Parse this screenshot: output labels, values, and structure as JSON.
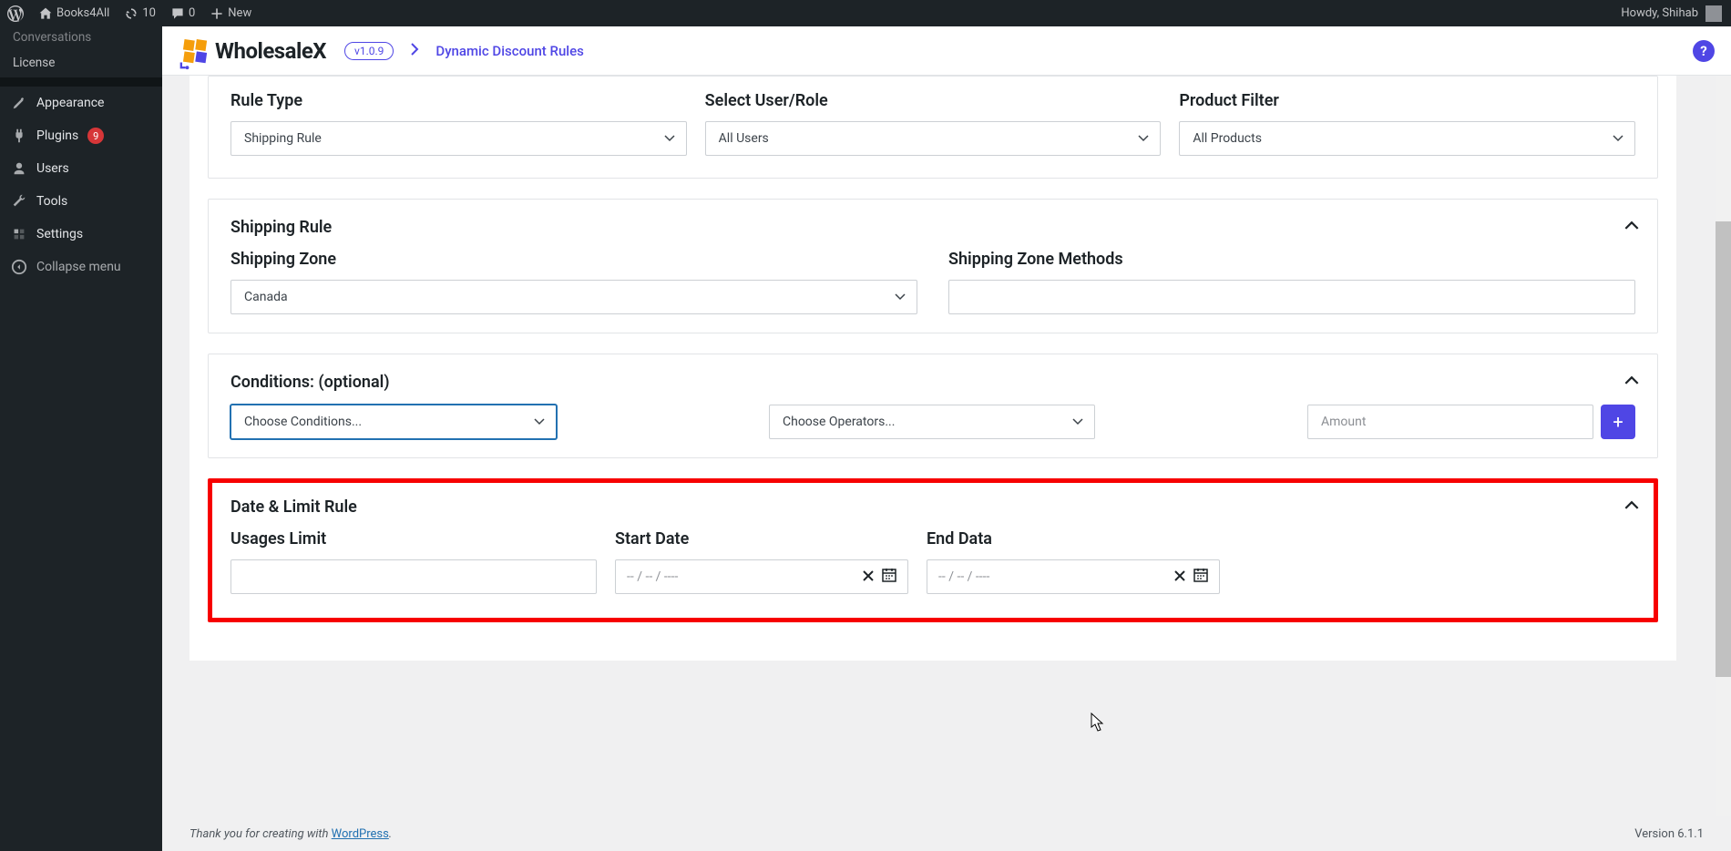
{
  "toolbar": {
    "site_name": "Books4All",
    "updates_count": "10",
    "comments_count": "0",
    "new_label": "New",
    "greeting": "Howdy, Shihab"
  },
  "sidebar": {
    "items": [
      {
        "label": "Conversations"
      },
      {
        "label": "License"
      },
      {
        "label": "Appearance"
      },
      {
        "label": "Plugins",
        "badge": "9"
      },
      {
        "label": "Users"
      },
      {
        "label": "Tools"
      },
      {
        "label": "Settings"
      },
      {
        "label": "Collapse menu"
      }
    ]
  },
  "header": {
    "brand": "WholesaleX",
    "version": "v1.0.9",
    "crumb": "Dynamic Discount Rules",
    "help": "?"
  },
  "panels": {
    "rule": {
      "rule_type_label": "Rule Type",
      "rule_type_value": "Shipping Rule",
      "user_label": "Select User/Role",
      "user_value": "All Users",
      "filter_label": "Product Filter",
      "filter_value": "All Products"
    },
    "shipping": {
      "title": "Shipping Rule",
      "zone_label": "Shipping Zone",
      "zone_value": "Canada",
      "methods_label": "Shipping Zone Methods"
    },
    "conditions": {
      "title": "Conditions: (optional)",
      "choose_cond": "Choose Conditions...",
      "choose_op": "Choose Operators...",
      "amount_ph": "Amount",
      "add": "+"
    },
    "datelimit": {
      "title": "Date & Limit Rule",
      "usages_label": "Usages Limit",
      "start_label": "Start Date",
      "end_label": "End Data",
      "date_ph": "--   /   --   /   ----"
    }
  },
  "footer": {
    "text_pre": "Thank you for creating with ",
    "link": "WordPress",
    "text_post": ".",
    "version": "Version 6.1.1"
  }
}
